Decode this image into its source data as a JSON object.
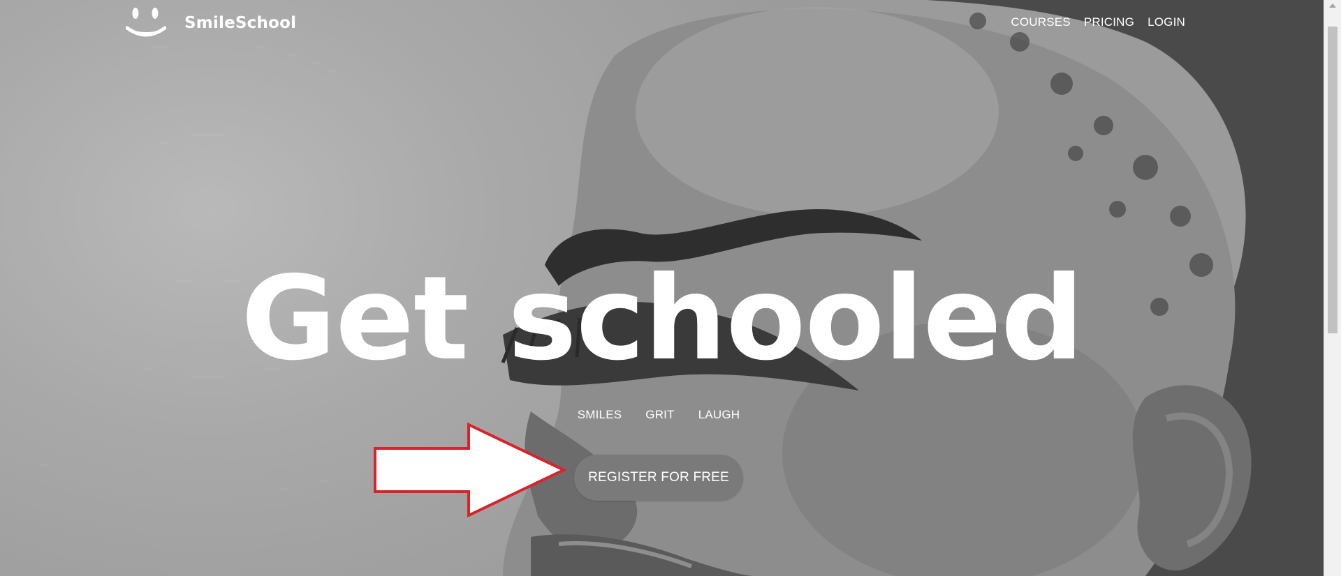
{
  "brand": {
    "name": "SmileSchool",
    "logo_icon": "smiley-face-icon"
  },
  "nav": {
    "items": [
      "COURSES",
      "PRICING",
      "LOGIN"
    ]
  },
  "hero": {
    "headline": "Get schooled",
    "tags": [
      "SMILES",
      "GRIT",
      "LAUGH"
    ],
    "cta_label": "REGISTER FOR FREE",
    "annotation_icon": "red-outlined-arrow-icon",
    "annotation_color": "#d8232a"
  },
  "colors": {
    "text": "#ffffff",
    "cta_background": "#7a7a7a"
  }
}
